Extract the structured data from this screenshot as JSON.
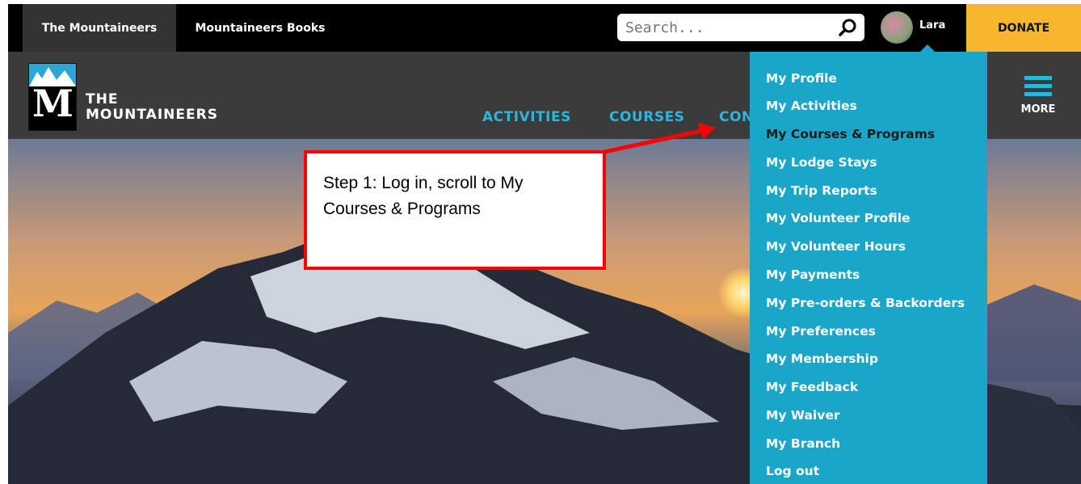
{
  "topbar": {
    "tab_active": "The Mountaineers",
    "tab_books": "Mountaineers Books",
    "search_placeholder": "Search...",
    "user_name": "Lara",
    "donate_label": "DONATE"
  },
  "header": {
    "logo_line1": "THE",
    "logo_line2": "MOUNTAINEERS",
    "nav": [
      "ACTIVITIES",
      "COURSES",
      "CON"
    ],
    "more_label": "MORE"
  },
  "dropdown": {
    "items": [
      "My Profile",
      "My Activities",
      "My Courses & Programs",
      "My Lodge Stays",
      "My Trip Reports",
      "My Volunteer Profile",
      "My Volunteer Hours",
      "My Payments",
      "My Pre-orders & Backorders",
      "My Preferences",
      "My Membership",
      "My Feedback",
      "My Waiver",
      "My Branch",
      "Log out"
    ]
  },
  "callout": {
    "text": "Step 1: Log in, scroll to My Courses & Programs"
  },
  "colors": {
    "accent_blue": "#1aa6c9",
    "donate_yellow": "#f6b72c",
    "callout_red": "#ff0000"
  }
}
